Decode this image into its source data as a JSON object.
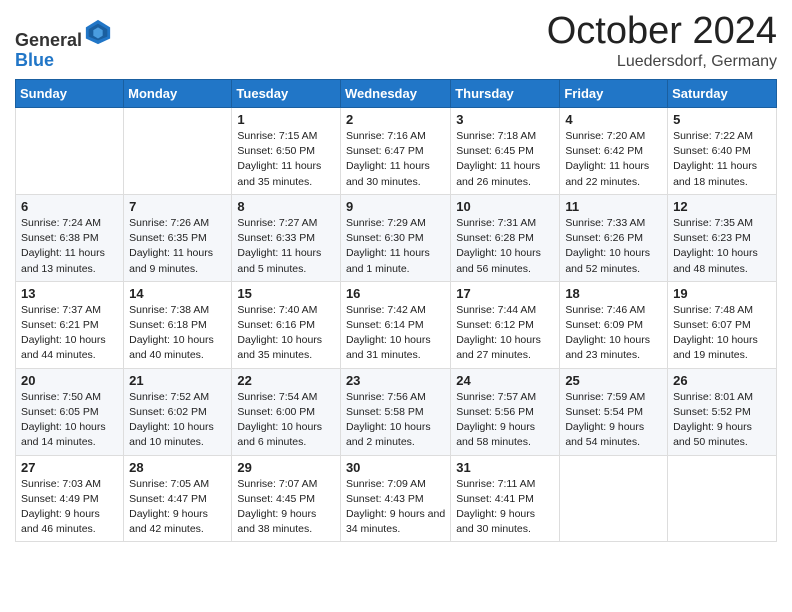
{
  "header": {
    "logo": {
      "general": "General",
      "blue": "Blue"
    },
    "month": "October 2024",
    "location": "Luedersdorf, Germany"
  },
  "weekdays": [
    "Sunday",
    "Monday",
    "Tuesday",
    "Wednesday",
    "Thursday",
    "Friday",
    "Saturday"
  ],
  "weeks": [
    [
      null,
      null,
      {
        "day": 1,
        "sunrise": "7:15 AM",
        "sunset": "6:50 PM",
        "daylight": "11 hours and 35 minutes."
      },
      {
        "day": 2,
        "sunrise": "7:16 AM",
        "sunset": "6:47 PM",
        "daylight": "11 hours and 30 minutes."
      },
      {
        "day": 3,
        "sunrise": "7:18 AM",
        "sunset": "6:45 PM",
        "daylight": "11 hours and 26 minutes."
      },
      {
        "day": 4,
        "sunrise": "7:20 AM",
        "sunset": "6:42 PM",
        "daylight": "11 hours and 22 minutes."
      },
      {
        "day": 5,
        "sunrise": "7:22 AM",
        "sunset": "6:40 PM",
        "daylight": "11 hours and 18 minutes."
      }
    ],
    [
      {
        "day": 6,
        "sunrise": "7:24 AM",
        "sunset": "6:38 PM",
        "daylight": "11 hours and 13 minutes."
      },
      {
        "day": 7,
        "sunrise": "7:26 AM",
        "sunset": "6:35 PM",
        "daylight": "11 hours and 9 minutes."
      },
      {
        "day": 8,
        "sunrise": "7:27 AM",
        "sunset": "6:33 PM",
        "daylight": "11 hours and 5 minutes."
      },
      {
        "day": 9,
        "sunrise": "7:29 AM",
        "sunset": "6:30 PM",
        "daylight": "11 hours and 1 minute."
      },
      {
        "day": 10,
        "sunrise": "7:31 AM",
        "sunset": "6:28 PM",
        "daylight": "10 hours and 56 minutes."
      },
      {
        "day": 11,
        "sunrise": "7:33 AM",
        "sunset": "6:26 PM",
        "daylight": "10 hours and 52 minutes."
      },
      {
        "day": 12,
        "sunrise": "7:35 AM",
        "sunset": "6:23 PM",
        "daylight": "10 hours and 48 minutes."
      }
    ],
    [
      {
        "day": 13,
        "sunrise": "7:37 AM",
        "sunset": "6:21 PM",
        "daylight": "10 hours and 44 minutes."
      },
      {
        "day": 14,
        "sunrise": "7:38 AM",
        "sunset": "6:18 PM",
        "daylight": "10 hours and 40 minutes."
      },
      {
        "day": 15,
        "sunrise": "7:40 AM",
        "sunset": "6:16 PM",
        "daylight": "10 hours and 35 minutes."
      },
      {
        "day": 16,
        "sunrise": "7:42 AM",
        "sunset": "6:14 PM",
        "daylight": "10 hours and 31 minutes."
      },
      {
        "day": 17,
        "sunrise": "7:44 AM",
        "sunset": "6:12 PM",
        "daylight": "10 hours and 27 minutes."
      },
      {
        "day": 18,
        "sunrise": "7:46 AM",
        "sunset": "6:09 PM",
        "daylight": "10 hours and 23 minutes."
      },
      {
        "day": 19,
        "sunrise": "7:48 AM",
        "sunset": "6:07 PM",
        "daylight": "10 hours and 19 minutes."
      }
    ],
    [
      {
        "day": 20,
        "sunrise": "7:50 AM",
        "sunset": "6:05 PM",
        "daylight": "10 hours and 14 minutes."
      },
      {
        "day": 21,
        "sunrise": "7:52 AM",
        "sunset": "6:02 PM",
        "daylight": "10 hours and 10 minutes."
      },
      {
        "day": 22,
        "sunrise": "7:54 AM",
        "sunset": "6:00 PM",
        "daylight": "10 hours and 6 minutes."
      },
      {
        "day": 23,
        "sunrise": "7:56 AM",
        "sunset": "5:58 PM",
        "daylight": "10 hours and 2 minutes."
      },
      {
        "day": 24,
        "sunrise": "7:57 AM",
        "sunset": "5:56 PM",
        "daylight": "9 hours and 58 minutes."
      },
      {
        "day": 25,
        "sunrise": "7:59 AM",
        "sunset": "5:54 PM",
        "daylight": "9 hours and 54 minutes."
      },
      {
        "day": 26,
        "sunrise": "8:01 AM",
        "sunset": "5:52 PM",
        "daylight": "9 hours and 50 minutes."
      }
    ],
    [
      {
        "day": 27,
        "sunrise": "7:03 AM",
        "sunset": "4:49 PM",
        "daylight": "9 hours and 46 minutes."
      },
      {
        "day": 28,
        "sunrise": "7:05 AM",
        "sunset": "4:47 PM",
        "daylight": "9 hours and 42 minutes."
      },
      {
        "day": 29,
        "sunrise": "7:07 AM",
        "sunset": "4:45 PM",
        "daylight": "9 hours and 38 minutes."
      },
      {
        "day": 30,
        "sunrise": "7:09 AM",
        "sunset": "4:43 PM",
        "daylight": "9 hours and 34 minutes."
      },
      {
        "day": 31,
        "sunrise": "7:11 AM",
        "sunset": "4:41 PM",
        "daylight": "9 hours and 30 minutes."
      },
      null,
      null
    ]
  ]
}
